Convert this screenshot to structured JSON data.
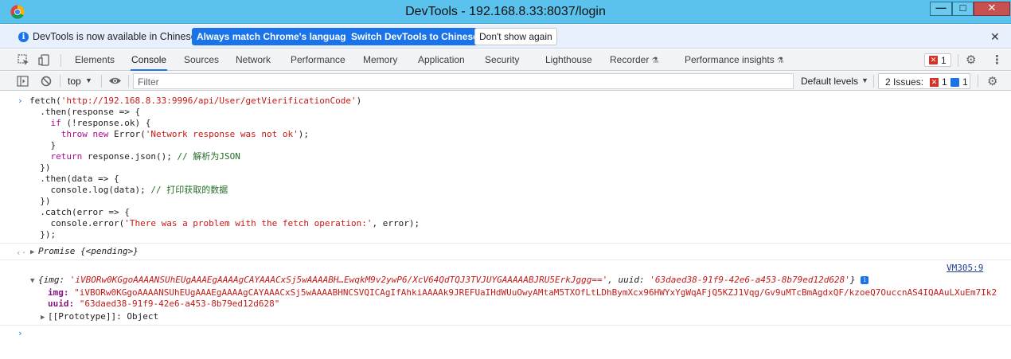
{
  "window": {
    "title": "DevTools - 192.168.8.33:8037/login",
    "minimize_glyph": "—",
    "maximize_glyph": "□",
    "close_glyph": "✕"
  },
  "infobar": {
    "message": "DevTools is now available in Chinese!",
    "btn_match": "Always match Chrome's language",
    "btn_switch": "Switch DevTools to Chinese",
    "btn_dismiss": "Don't show again",
    "close_glyph": "✕"
  },
  "tabs": [
    {
      "label": "Elements"
    },
    {
      "label": "Console"
    },
    {
      "label": "Sources"
    },
    {
      "label": "Network"
    },
    {
      "label": "Performance"
    },
    {
      "label": "Memory"
    },
    {
      "label": "Application"
    },
    {
      "label": "Security"
    },
    {
      "label": "Lighthouse"
    },
    {
      "label": "Recorder"
    },
    {
      "label": "Performance insights"
    }
  ],
  "active_tab": "Console",
  "error_count": "1",
  "console_toolbar": {
    "context": "top",
    "filter_placeholder": "Filter",
    "default_levels": "Default levels",
    "issues_label": "2 Issues:",
    "issues_errors": "1",
    "issues_info": "1"
  },
  "console": {
    "input_lines": [
      "fetch('http://192.168.8.33:9996/api/User/getVierificationCode')",
      "  .then(response => {",
      "    if (!response.ok) {",
      "      throw new Error('Network response was not ok');",
      "    }",
      "    return response.json(); // 解析为JSON",
      "  })",
      "  .then(data => {",
      "    console.log(data); // 打印获取的数据",
      "  })",
      "  .catch(error => {",
      "    console.error('There was a problem with the fetch operation:', error);",
      "  });"
    ],
    "result_prefix": "Promise",
    "result_state": "{<pending>}",
    "source_link": "VM305:9",
    "object_summary": {
      "open": "{img: ",
      "img": "'iVBORw0KGgoAAAANSUhEUgAAAEgAAAAgCAYAAACxSj5wAAAABH…EwqkM9v2ywP6/XcV64QdTQJ3TVJUYGAAAAABJRU5ErkJggg=='",
      "sep": ", uuid: ",
      "uuid": "'63daed38-91f9-42e6-a453-8b79ed12d628'",
      "close": "}"
    },
    "img_key": "img:",
    "img_value": "\"iVBORw0KGgoAAAANSUhEUgAAAEgAAAAgCAYAAACxSj5wAAAABHNCSVQICAgIfAhkiAAAAk9JREFUaIHdWUuOwyAMtaM5TXOfLtLDhBymXcx96HWYxYgWqAFjQ5KZJ1Vqg/Gv9uMTcBmAgdxQF/kzoeQ7OuccnAS4IQAAuLXuEm7Ik2",
    "uuid_key": "uuid:",
    "uuid_value": "\"63daed38-91f9-42e6-a453-8b79ed12d628\"",
    "prototype": "[[Prototype]]: Object"
  }
}
